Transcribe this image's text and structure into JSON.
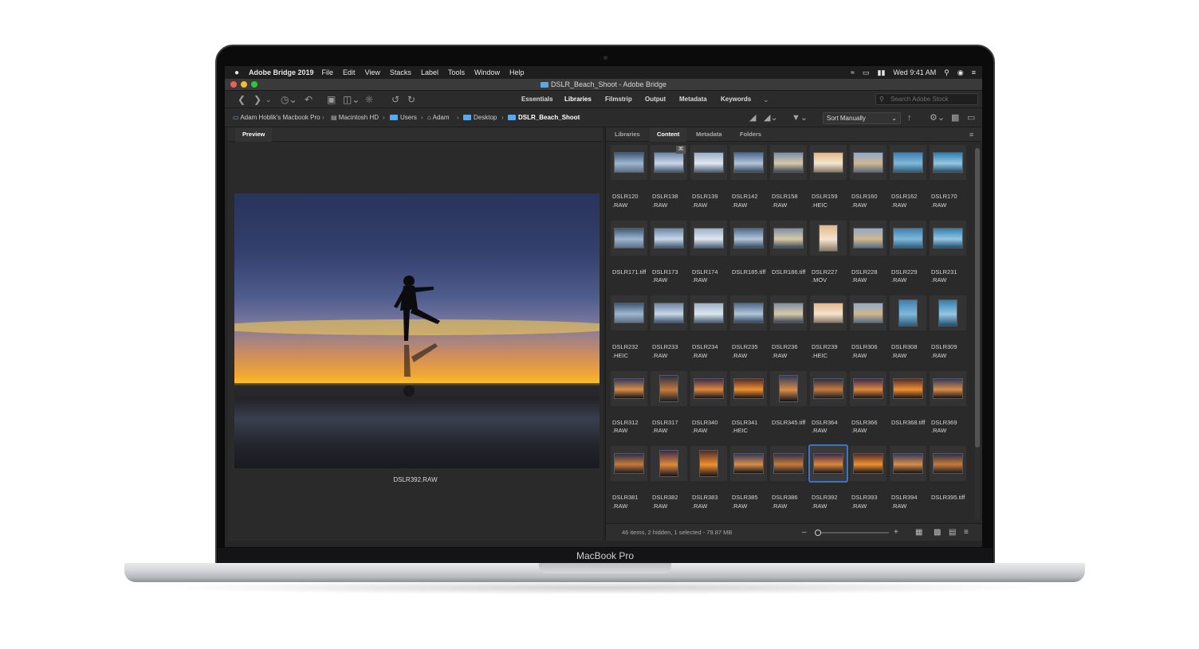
{
  "macbook": {
    "model_label": "MacBook Pro"
  },
  "menubar": {
    "app_name": "Adobe Bridge 2019",
    "menus": [
      "File",
      "Edit",
      "View",
      "Stacks",
      "Label",
      "Tools",
      "Window",
      "Help"
    ],
    "clock": "Wed 9:41 AM"
  },
  "window": {
    "title": "DSLR_Beach_Shoot - Adobe Bridge"
  },
  "toolbar": {
    "workspaces": [
      "Essentials",
      "Libraries",
      "Filmstrip",
      "Output",
      "Metadata",
      "Keywords"
    ],
    "active_workspace": "Libraries",
    "search_placeholder": "Search Adobe Stock"
  },
  "pathbar": {
    "crumbs": [
      "Adam Hoblik's Macbook Pro",
      "Macintosh HD",
      "Users",
      "Adam",
      "Desktop",
      "DSLR_Beach_Shoot"
    ],
    "sort": "Sort Manually"
  },
  "preview": {
    "tab": "Preview",
    "caption": "DSLR392.RAW"
  },
  "content": {
    "tabs": [
      "Libraries",
      "Content",
      "Metadata",
      "Folders"
    ],
    "active_tab": "Content",
    "items": [
      {
        "line1": "DSLR120",
        "line2": ".RAW"
      },
      {
        "line1": "DSLR138",
        "line2": ".RAW"
      },
      {
        "line1": "DSLR139",
        "line2": ".RAW"
      },
      {
        "line1": "DSLR142",
        "line2": ".RAW"
      },
      {
        "line1": "DSLR158",
        "line2": ".RAW"
      },
      {
        "line1": "DSLR159",
        "line2": ".HEIC"
      },
      {
        "line1": "DSLR160",
        "line2": ".RAW"
      },
      {
        "line1": "DSLR162",
        "line2": ".RAW"
      },
      {
        "line1": "DSLR170",
        "line2": ".RAW"
      },
      {
        "line1": "DSLR171.tiff",
        "line2": ""
      },
      {
        "line1": "DSLR173",
        "line2": ".RAW"
      },
      {
        "line1": "DSLR174",
        "line2": ".RAW"
      },
      {
        "line1": "DSLR185.tiff",
        "line2": ""
      },
      {
        "line1": "DSLR186.tiff",
        "line2": ""
      },
      {
        "line1": "DSLR227",
        "line2": ".MOV"
      },
      {
        "line1": "DSLR228",
        "line2": ".RAW"
      },
      {
        "line1": "DSLR229",
        "line2": ".RAW"
      },
      {
        "line1": "DSLR231",
        "line2": ".RAW"
      },
      {
        "line1": "DSLR232",
        "line2": ".HEIC"
      },
      {
        "line1": "DSLR233",
        "line2": ".RAW"
      },
      {
        "line1": "DSLR234",
        "line2": ".RAW"
      },
      {
        "line1": "DSLR235",
        "line2": ".RAW"
      },
      {
        "line1": "DSLR236",
        "line2": ".RAW"
      },
      {
        "line1": "DSLR239",
        "line2": ".HEIC"
      },
      {
        "line1": "DSLR306",
        "line2": ".RAW"
      },
      {
        "line1": "DSLR308",
        "line2": ".RAW"
      },
      {
        "line1": "DSLR309",
        "line2": ".RAW"
      },
      {
        "line1": "DSLR312",
        "line2": ".RAW"
      },
      {
        "line1": "DSLR317",
        "line2": ".RAW"
      },
      {
        "line1": "DSLR340",
        "line2": ".RAW"
      },
      {
        "line1": "DSLR341",
        "line2": ".HEIC"
      },
      {
        "line1": "DSLR345.tiff",
        "line2": ""
      },
      {
        "line1": "DSLR364",
        "line2": ".RAW"
      },
      {
        "line1": "DSLR366",
        "line2": ".RAW"
      },
      {
        "line1": "DSLR368.tiff",
        "line2": ""
      },
      {
        "line1": "DSLR369",
        "line2": ".RAW"
      },
      {
        "line1": "DSLR381",
        "line2": ".RAW"
      },
      {
        "line1": "DSLR382",
        "line2": ".RAW"
      },
      {
        "line1": "DSLR383",
        "line2": ".RAW"
      },
      {
        "line1": "DSLR385",
        "line2": ".RAW"
      },
      {
        "line1": "DSLR386",
        "line2": ".RAW"
      },
      {
        "line1": "DSLR392",
        "line2": ".RAW"
      },
      {
        "line1": "DSLR393",
        "line2": ".RAW"
      },
      {
        "line1": "DSLR394",
        "line2": ".RAW"
      },
      {
        "line1": "DSLR395.tiff",
        "line2": ""
      }
    ],
    "selected_item": "DSLR392",
    "status": "46 items, 2 hidden, 1 selected - 79.87 MB"
  },
  "colors": {
    "selection": "#3e73c4",
    "folder": "#5aa8e8",
    "panel_bg": "#2a2a2a"
  }
}
